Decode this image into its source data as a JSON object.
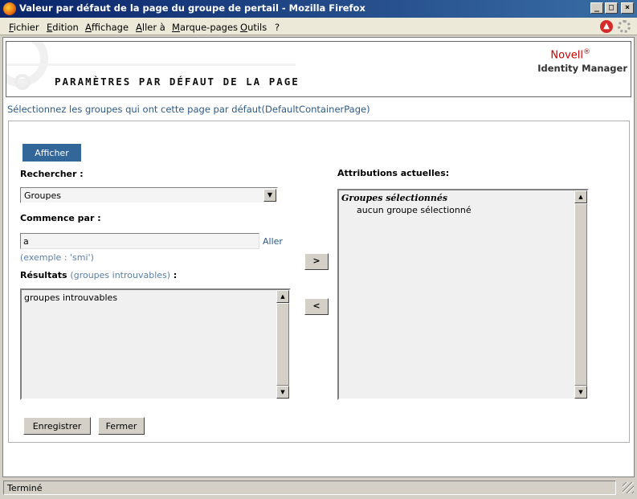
{
  "window": {
    "title": "Valeur par défaut de la page du groupe de pertail - Mozilla Firefox",
    "minimize": "_",
    "maximize": "□",
    "close": "×"
  },
  "menu": [
    "Fichier",
    "Edition",
    "Affichage",
    "Aller à",
    "Marque-pages",
    "Outils",
    "?"
  ],
  "header": {
    "page_title": "PARAMÈTRES PAR DÉFAUT DE LA PAGE",
    "brand": "Novell",
    "brand_mark": "®",
    "product": "Identity Manager"
  },
  "instruction": "Sélectionnez les groupes qui ont cette page par défaut(DefaultContainerPage)",
  "form": {
    "show_button": "Afficher",
    "search_label": "Rechercher :",
    "search_type": "Groupes",
    "starts_with_label": "Commence par :",
    "starts_with_value": "a",
    "go_link": "Aller",
    "example": "(exemple : 'smi')",
    "results_label": "Résultats",
    "results_note": "(groupes introuvables)",
    "results_colon": ":",
    "results_items": [
      "groupes introuvables"
    ],
    "assignments_label": "Attributions actuelles:",
    "assignments_heading": "Groupes sélectionnés",
    "assignments_items": [
      "aucun groupe sélectionné"
    ],
    "add_arrow": ">",
    "remove_arrow": "<",
    "save_button": "Enregistrer",
    "close_button": "Fermer"
  },
  "status": {
    "text": "Terminé"
  },
  "colors": {
    "titlebar_start": "#0a246a",
    "titlebar_end": "#3a6ea5",
    "accent_button": "#336699",
    "link": "#2c5a8a",
    "brand_red": "#cc0000"
  }
}
